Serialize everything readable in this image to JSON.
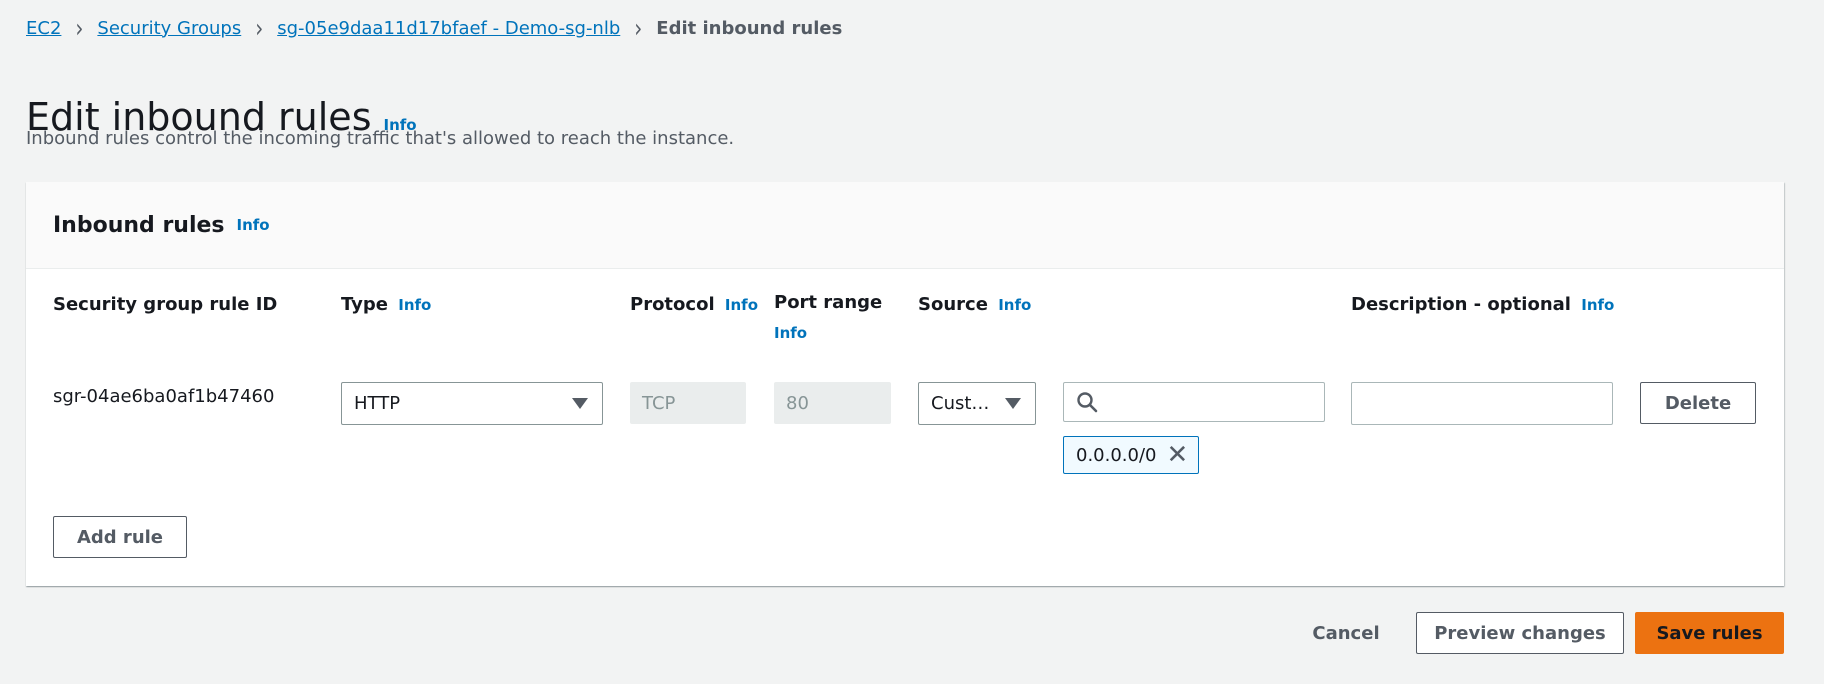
{
  "breadcrumb": {
    "items": [
      "EC2",
      "Security Groups",
      "sg-05e9daa11d17bfaef - Demo-sg-nlb"
    ],
    "current": "Edit inbound rules"
  },
  "page": {
    "title": "Edit inbound rules",
    "info": "Info",
    "description": "Inbound rules control the incoming traffic that's allowed to reach the instance."
  },
  "panel": {
    "title": "Inbound rules",
    "info": "Info",
    "columns": {
      "rule_id": "Security group rule ID",
      "type": "Type",
      "protocol": "Protocol",
      "port_range": "Port range",
      "source": "Source",
      "description": "Description - optional",
      "info": "Info"
    },
    "rule": {
      "id": "sgr-04ae6ba0af1b47460",
      "type": "HTTP",
      "protocol": "TCP",
      "port": "80",
      "source_type": "Cust…",
      "source_search": "",
      "source_token": "0.0.0.0/0",
      "description": "",
      "delete_label": "Delete"
    },
    "add_rule_label": "Add rule"
  },
  "footer": {
    "cancel_label": "Cancel",
    "preview_label": "Preview changes",
    "save_label": "Save rules"
  },
  "colors": {
    "link": "#0073bb",
    "primary": "#ec7211",
    "background": "#f2f3f3"
  }
}
